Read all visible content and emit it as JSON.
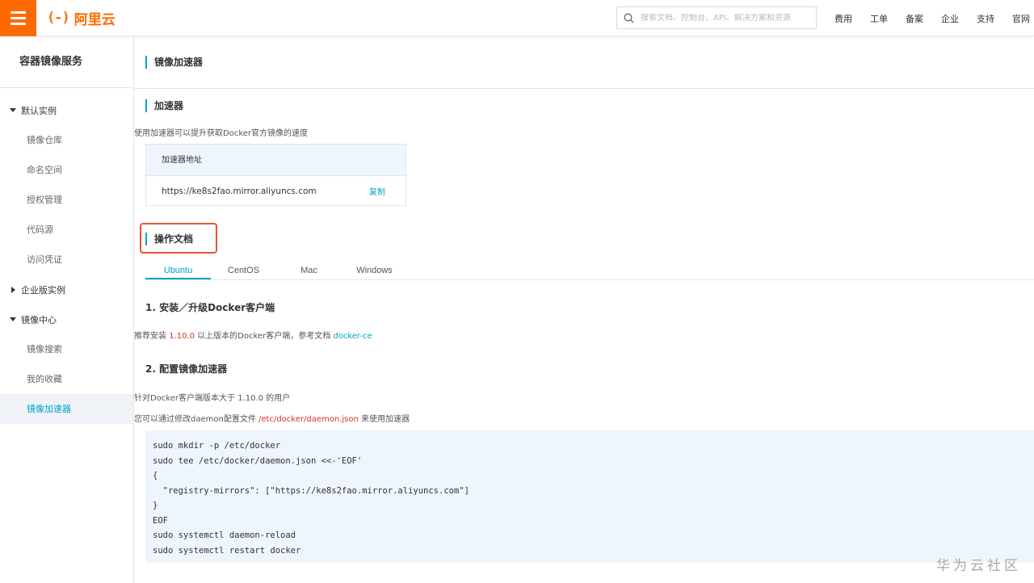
{
  "header": {
    "logo_mark": "(-)",
    "logo_text": "阿里云",
    "search_placeholder": "搜索文档、控制台、API、解决方案和资源",
    "nav": [
      "费用",
      "工单",
      "备案",
      "企业",
      "支持",
      "官网"
    ]
  },
  "sidebar": {
    "title": "容器镜像服务",
    "groups": [
      {
        "label": "默认实例",
        "expanded": true,
        "items": [
          "镜像仓库",
          "命名空间",
          "授权管理",
          "代码源",
          "访问凭证"
        ]
      },
      {
        "label": "企业版实例",
        "expanded": false,
        "items": []
      },
      {
        "label": "镜像中心",
        "expanded": true,
        "items": [
          "镜像搜索",
          "我的收藏",
          "镜像加速器"
        ]
      }
    ],
    "active_item": "镜像加速器"
  },
  "main": {
    "page_title": "镜像加速器",
    "accelerator": {
      "title": "加速器",
      "description": "使用加速器可以提升获取Docker官方镜像的速度",
      "address_label": "加速器地址",
      "address": "https://ke8s2fao.mirror.aliyuncs.com",
      "copy_label": "复制"
    },
    "docs": {
      "title": "操作文档",
      "tabs": [
        "Ubuntu",
        "CentOS",
        "Mac",
        "Windows"
      ],
      "active_tab": "Ubuntu",
      "step1_title": "1. 安装／升级Docker客户端",
      "step1_prefix": "推荐安装 ",
      "step1_version": "1.10.0",
      "step1_middle": " 以上版本的Docker客户端，参考文档 ",
      "step1_link": "docker-ce",
      "step2_title": "2. 配置镜像加速器",
      "step2_line1": "针对Docker客户端版本大于 1.10.0 的用户",
      "step2_line2_prefix": "您可以通过修改daemon配置文件 ",
      "step2_line2_path": "/etc/docker/daemon.json",
      "step2_line2_suffix": " 来使用加速器",
      "code_lines": [
        "sudo mkdir -p /etc/docker",
        "sudo tee /etc/docker/daemon.json <<-'EOF'",
        "{",
        "  \"registry-mirrors\": [\"https://ke8s2fao.mirror.aliyuncs.com\"]",
        "}",
        "EOF",
        "sudo systemctl daemon-reload",
        "sudo systemctl restart docker"
      ]
    }
  },
  "watermark": "华为云社区",
  "colors": {
    "brand": "#ff6a00",
    "accent": "#00a2ca",
    "highlight_red": "#d93026",
    "annotation_box": "#e8533a"
  }
}
